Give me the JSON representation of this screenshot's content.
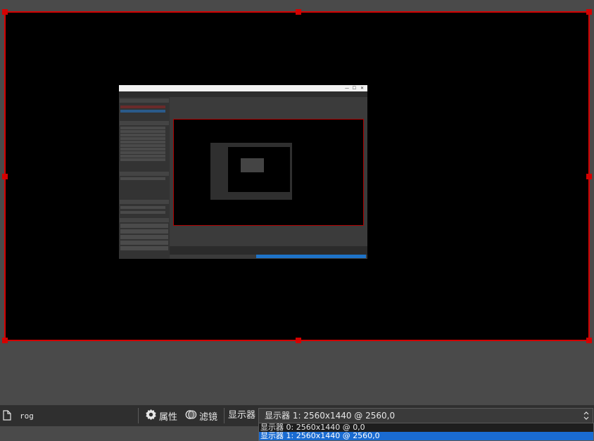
{
  "preview": {
    "outline_color": "#d50000",
    "canvas_color": "#000000"
  },
  "bottombar": {
    "source_icon": "file-icon",
    "source_name": "rog",
    "properties_icon": "gear-icon",
    "properties_label": "属性",
    "filters_icon": "filter-icon",
    "filters_label": "滤镜",
    "display_label": "显示器",
    "display_selected": "显示器 1: 2560x1440 @ 2560,0",
    "dropdown_options": [
      "显示器 0: 2560x1440 @ 0,0",
      "显示器 1: 2560x1440 @ 2560,0"
    ],
    "highlight_color": "#1a6bd1"
  }
}
